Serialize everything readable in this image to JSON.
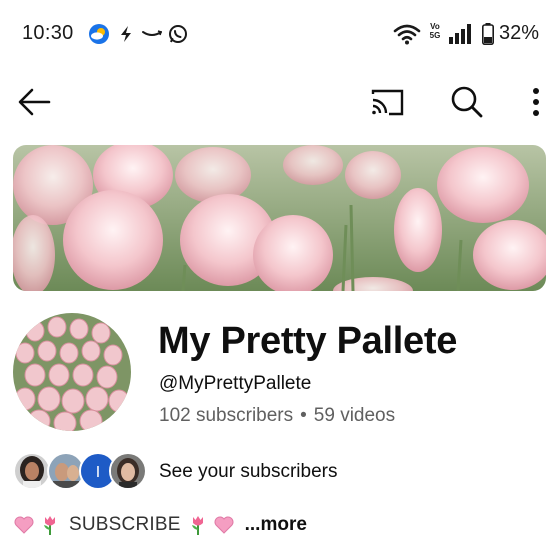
{
  "status_bar": {
    "time": "10:30",
    "battery": "32%",
    "volte_line1": "Vo",
    "volte_line2": "5G",
    "icons": [
      "weather-icon",
      "bolt-icon",
      "amazon-icon",
      "whatsapp-icon",
      "wifi-icon",
      "signal-icon",
      "battery-icon"
    ]
  },
  "app_bar": {
    "icons": [
      "back-arrow-icon",
      "cast-icon",
      "search-icon",
      "more-vert-icon"
    ]
  },
  "channel": {
    "name": "My Pretty Pallete",
    "handle": "@MyPrettyPallete",
    "subscribers": "102 subscribers",
    "separator": "•",
    "videos": "59 videos",
    "see_subscribers": "See your subscribers",
    "subscriber_avatar_initial": "I"
  },
  "description": {
    "text": "SUBSCRIBE",
    "more": "...more",
    "emojis": [
      "heart-emoji",
      "tulip-emoji",
      "tulip-emoji",
      "heart-emoji"
    ]
  },
  "colors": {
    "primary_text": "#0f0f0f",
    "secondary_text": "#606060",
    "avatar_blue": "#1e5bc6",
    "banner_pink": "#f2c3c9",
    "banner_green": "#5f7d4f"
  }
}
